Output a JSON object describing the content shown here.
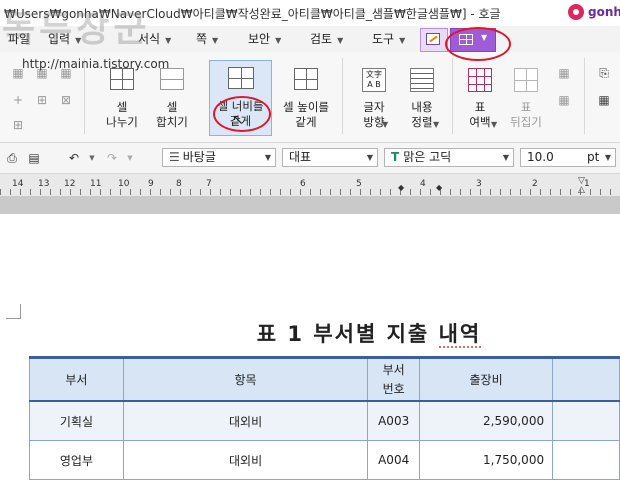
{
  "title_bar": {
    "path": "₩Users₩gonha₩NaverCloud₩아티클₩작성완료_아티클₩아티클_샘플₩한글샘플₩] - 호글",
    "logo_text": "gonha"
  },
  "menu": {
    "items": [
      {
        "label": "파일",
        "caret": false
      },
      {
        "label": "입력",
        "caret": true
      },
      {
        "label": "서식",
        "caret": true
      },
      {
        "label": "쪽",
        "caret": true
      },
      {
        "label": "보안",
        "caret": true
      },
      {
        "label": "검토",
        "caret": true
      },
      {
        "label": "도구",
        "caret": true
      }
    ]
  },
  "ribbon": {
    "cell_split": "셀\n나누기",
    "cell_merge": "셀\n합치기",
    "cell_width": "셀 너비를\n같게",
    "cell_height": "셀 높이를\n같게",
    "text_direction": "글자\n방향",
    "content_align": "내용\n정렬",
    "table_margin": "표\n여백",
    "table_flip": "표\n뒤집기"
  },
  "format_bar": {
    "style": "바탕글",
    "font_group": "대표",
    "font": "맑은 고딕",
    "size": "10.0",
    "unit": "pt"
  },
  "ruler": [
    "14",
    "13",
    "12",
    "11",
    "10",
    "9",
    "8",
    "7",
    "6",
    "5",
    "4",
    "3",
    "2",
    "1"
  ],
  "watermark": {
    "title": "독두장군",
    "url": "http://mainia.tistory.com"
  },
  "document": {
    "title_prefix": "표 1 부서별 지출 ",
    "title_emph": "내역",
    "table": {
      "headers": [
        "부서",
        "항목",
        "부서\n번호",
        "출장비"
      ],
      "rows": [
        [
          "기획실",
          "대외비",
          "A003",
          "2,590,000"
        ],
        [
          "영업부",
          "대외비",
          "A004",
          "1,750,000"
        ]
      ]
    }
  },
  "colors": {
    "accent_purple": "#a05bd6",
    "highlight_blue": "#dbe7f7",
    "table_header": "#d7e5f5",
    "table_border": "#3a5f9a",
    "annotation_red": "#e0162b"
  }
}
